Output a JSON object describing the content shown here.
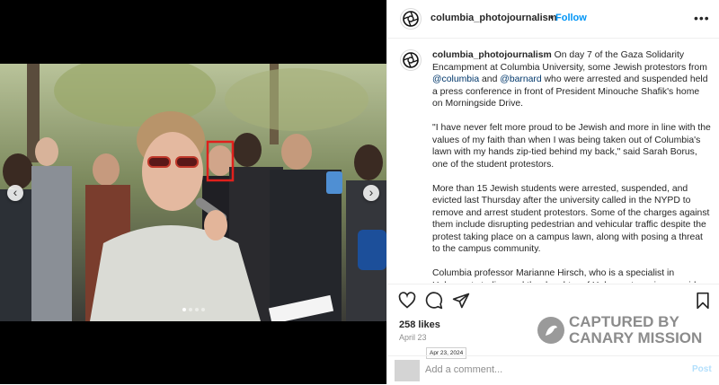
{
  "header": {
    "username": "columbia_photojournalism",
    "separator": "•",
    "follow_label": "Follow",
    "more_icon": "more-options-icon",
    "more_glyph": "•••"
  },
  "caption": {
    "username": "columbia_photojournalism",
    "p1_a": "On day 7 of the Gaza Solidarity Encampment at Columbia University, some Jewish protestors from",
    "mention1": "@columbia",
    "p1_b": "and",
    "mention2": "@barnard",
    "p1_c": "who were arrested and suspended held a press conference in front of President Minouche Shafik's home on Morningside Drive.",
    "p2": "\"I have never felt more proud to be Jewish and more in line with the values of my faith than when I was being taken out of Columbia's lawn with my hands zip-tied behind my back,\" said Sarah Borus, one of the student protestors.",
    "p3": "More than 15 Jewish students were arrested, suspended, and evicted last Thursday after the university called in the NYPD to remove and arrest student protestors. Some of the charges against them include disrupting pedestrian and vehicular traffic despite the protest taking place on a campus lawn, along with posing a threat to the campus community.",
    "p4": "Columbia professor Marianne Hirsch, who is a specialist in Holocaust studies and the daughter of Holocaust survivors, said"
  },
  "media": {
    "prev_glyph": "‹",
    "next_glyph": "›",
    "dot_count": 4,
    "active_dot": 0
  },
  "actions": {
    "like_icon": "heart-icon",
    "comment_icon": "comment-icon",
    "share_icon": "share-icon",
    "save_icon": "bookmark-icon"
  },
  "likes": "258 likes",
  "date": "April 23",
  "tooltip": "Apr 23, 2024",
  "comment": {
    "placeholder": "Add a comment...",
    "post_label": "Post"
  },
  "watermark": {
    "line1": "CAPTURED BY",
    "line2": "CANARY MISSION"
  },
  "colors": {
    "link": "#00376b",
    "follow": "#0095f6",
    "highlight_box": "#e0201c"
  }
}
